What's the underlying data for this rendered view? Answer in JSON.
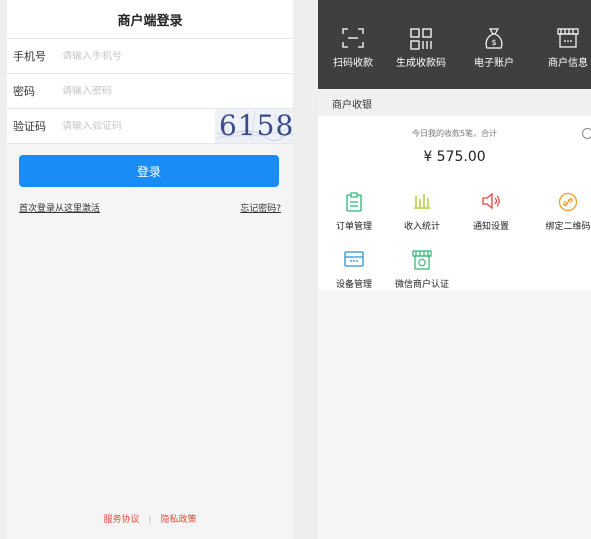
{
  "login": {
    "title": "商户端登录",
    "fields": [
      {
        "label": "手机号",
        "placeholder": "请输入手机号"
      },
      {
        "label": "密码",
        "placeholder": "请输入密码"
      },
      {
        "label": "验证码",
        "placeholder": "请输入验证码"
      }
    ],
    "captcha_text": "6158",
    "login_button": "登录",
    "first_login_link": "首次登录从这里激活",
    "forgot_password_link": "忘记密码?",
    "footer": {
      "terms": "服务协议",
      "separator": "|",
      "privacy": "隐私政策"
    },
    "colors": {
      "primary": "#1a8cf6",
      "footer_link": "#e14a3a"
    }
  },
  "home": {
    "topbar": {
      "items": [
        {
          "label": "扫码收款",
          "icon": "scan-icon"
        },
        {
          "label": "生成收款码",
          "icon": "qrcode-icon"
        },
        {
          "label": "电子账户",
          "icon": "money-bag-icon"
        },
        {
          "label": "商户信息",
          "icon": "store-icon"
        }
      ],
      "background": "#3f3f3f"
    },
    "section_title": "商户收银",
    "summary": {
      "line": "今日我的收款5笔，合计",
      "amount": "¥ 575.00"
    },
    "grid": [
      {
        "label": "订单管理",
        "icon": "clipboard-icon",
        "color": "#2bb673"
      },
      {
        "label": "收入统计",
        "icon": "bar-chart-icon",
        "color": "#a3c21f"
      },
      {
        "label": "通知设置",
        "icon": "speaker-icon",
        "color": "#e8433a"
      },
      {
        "label": "绑定二维码",
        "icon": "link-icon",
        "color": "#f39c2b"
      },
      {
        "label": "设备管理",
        "icon": "device-icon",
        "color": "#2f8fd8"
      },
      {
        "label": "微信商户认证",
        "icon": "wechat-store-icon",
        "color": "#2bb673"
      }
    ]
  }
}
